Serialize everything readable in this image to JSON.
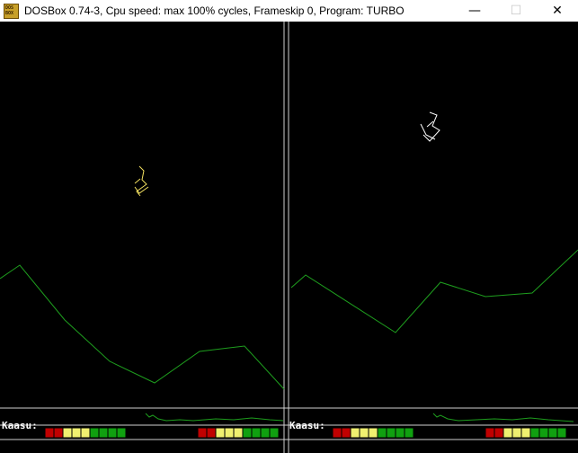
{
  "window": {
    "title": "DOSBox 0.74-3, Cpu speed: max 100% cycles, Frameskip  0, Program:    TURBO",
    "icon_label_top": "DOS",
    "icon_label_bottom": "BOX",
    "minimize_glyph": "—",
    "maximize_glyph": "☐",
    "close_glyph": "✕"
  },
  "game": {
    "program": "TURBO",
    "hud": {
      "left_label": "Kaasu:",
      "right_label": "Kaasu:"
    },
    "colors": {
      "terrain": "#1e9e1e",
      "player1": "#f2e060",
      "player2": "#ffffff",
      "divider": "#d0d0d0",
      "gauge_red": "#c00000",
      "gauge_yellow": "#f0f070",
      "gauge_green": "#10a010"
    }
  }
}
